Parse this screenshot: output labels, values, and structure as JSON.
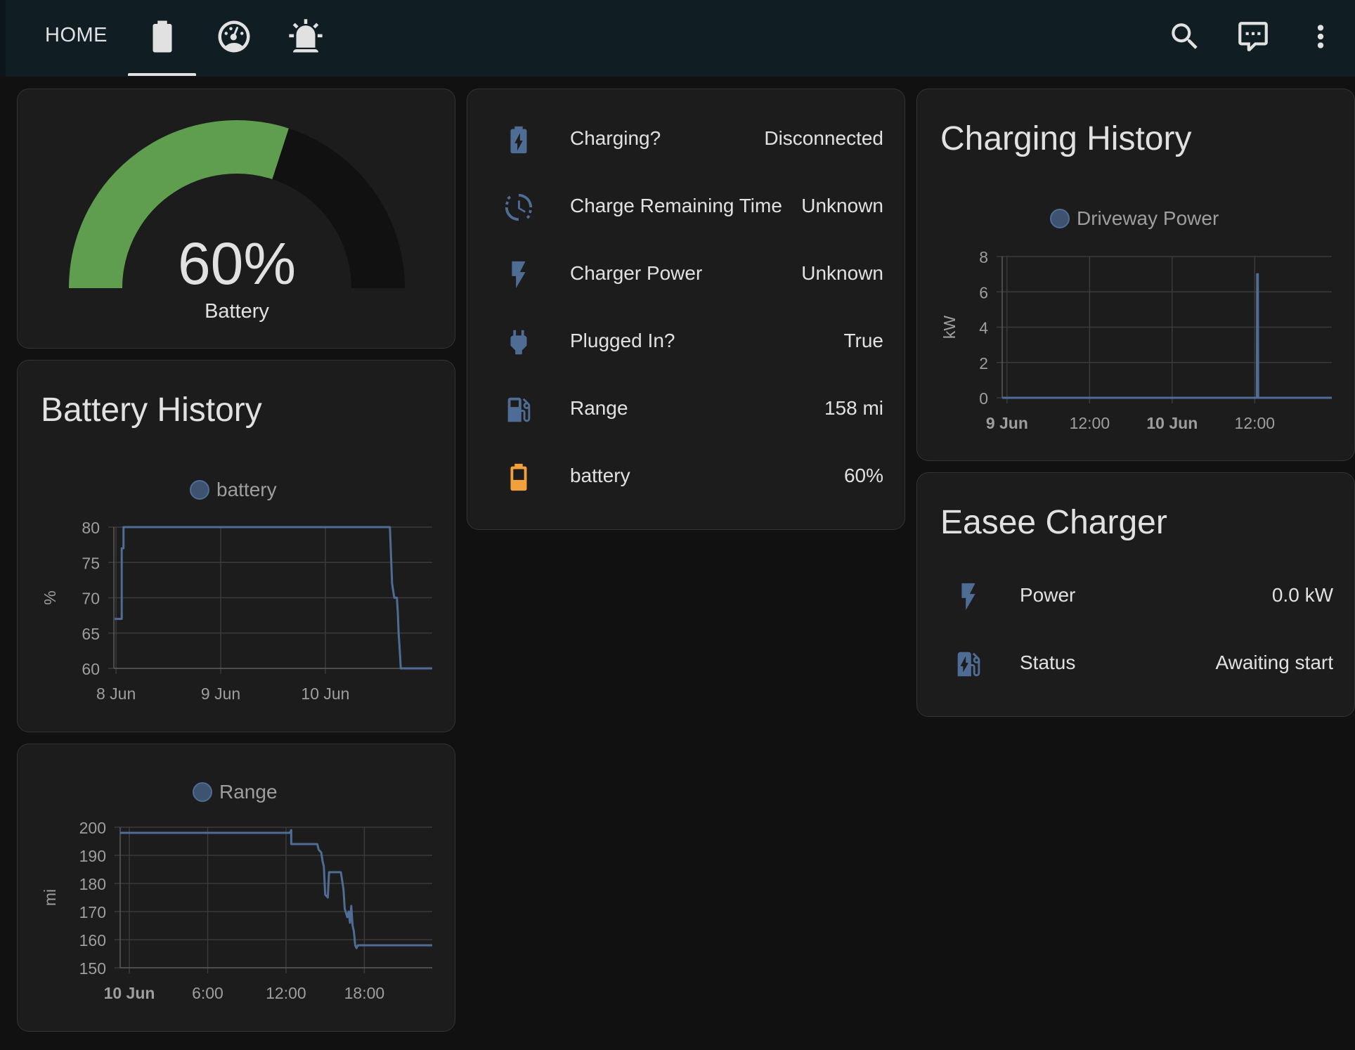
{
  "header": {
    "home_label": "HOME",
    "tabs": [
      {
        "icon": "battery-icon",
        "active": true
      },
      {
        "icon": "speedometer-icon",
        "active": false
      },
      {
        "icon": "alarm-light-icon",
        "active": false
      }
    ],
    "actions": [
      "search-icon",
      "assist-chat-icon",
      "more-vertical-icon"
    ]
  },
  "gauge": {
    "value_text": "60%",
    "label": "Battery",
    "level": 0.6,
    "color": "#5f9e4f"
  },
  "entities": {
    "rows": [
      {
        "icon": "battery-charging-icon",
        "label": "Charging?",
        "value": "Disconnected"
      },
      {
        "icon": "timer-sand-icon",
        "label": "Charge Remaining Time",
        "value": "Unknown"
      },
      {
        "icon": "flash-icon",
        "label": "Charger Power",
        "value": "Unknown"
      },
      {
        "icon": "power-plug-icon",
        "label": "Plugged In?",
        "value": "True"
      },
      {
        "icon": "gas-station-icon",
        "label": "Range",
        "value": "158 mi"
      },
      {
        "icon": "battery-icon",
        "label": "battery",
        "value": "60%"
      }
    ],
    "icon_color": "#4f6c94",
    "battery_icon_color": "#f2a03d"
  },
  "battery_history": {
    "title": "Battery History"
  },
  "charging_history": {
    "title": "Charging History"
  },
  "easee": {
    "title": "Easee Charger",
    "rows": [
      {
        "icon": "flash-icon",
        "label": "Power",
        "value": "0.0 kW"
      },
      {
        "icon": "ev-station-icon",
        "label": "Status",
        "value": "Awaiting start"
      }
    ]
  },
  "chart_data": [
    {
      "id": "battery",
      "type": "line",
      "series": [
        {
          "name": "battery",
          "color": "#4f6c94"
        }
      ],
      "ylabel": "%",
      "ylim": [
        60,
        80
      ],
      "yticks": [
        80,
        75,
        70,
        65,
        60
      ],
      "xticks": [
        "8 Jun",
        "9 Jun",
        "10 Jun"
      ],
      "x_hours": [
        0,
        24,
        48
      ],
      "xlim": [
        -0.5,
        72.5
      ],
      "points": [
        [
          -0.3,
          67
        ],
        [
          1.3,
          67
        ],
        [
          1.3,
          77
        ],
        [
          1.7,
          77
        ],
        [
          1.7,
          80
        ],
        [
          62.8,
          80
        ],
        [
          63.3,
          72
        ],
        [
          63.8,
          70
        ],
        [
          64.4,
          70
        ],
        [
          64.6,
          68
        ],
        [
          64.8,
          65
        ],
        [
          65.1,
          62
        ],
        [
          65.3,
          60
        ],
        [
          72.5,
          60
        ]
      ]
    },
    {
      "id": "range",
      "type": "line",
      "series": [
        {
          "name": "Range",
          "color": "#4f6c94"
        }
      ],
      "ylabel": "mi",
      "ylim": [
        150,
        200
      ],
      "yticks": [
        200,
        190,
        180,
        170,
        160,
        150
      ],
      "xticks": [
        "10 Jun",
        "6:00",
        "12:00",
        "18:00"
      ],
      "xticks_bold": [
        true,
        false,
        false,
        false
      ],
      "x_hours": [
        0,
        6,
        12,
        18
      ],
      "xlim": [
        -0.7,
        23.2
      ],
      "points": [
        [
          -0.7,
          198
        ],
        [
          12.3,
          198
        ],
        [
          12.4,
          199
        ],
        [
          12.4,
          194
        ],
        [
          14.4,
          194
        ],
        [
          14.5,
          192
        ],
        [
          14.7,
          191
        ],
        [
          14.8,
          188
        ],
        [
          14.9,
          186
        ],
        [
          15.0,
          176
        ],
        [
          15.2,
          175
        ],
        [
          15.3,
          184
        ],
        [
          16.2,
          184
        ],
        [
          16.4,
          178
        ],
        [
          16.5,
          171
        ],
        [
          16.7,
          168
        ],
        [
          16.8,
          170
        ],
        [
          16.9,
          166
        ],
        [
          17.0,
          172
        ],
        [
          17.1,
          165
        ],
        [
          17.2,
          163
        ],
        [
          17.3,
          158
        ],
        [
          17.4,
          157
        ],
        [
          17.5,
          158
        ],
        [
          23.2,
          158
        ]
      ]
    },
    {
      "id": "driveway",
      "type": "line",
      "series": [
        {
          "name": "Driveway Power",
          "color": "#4f6c94"
        }
      ],
      "ylabel": "kW",
      "ylim": [
        0,
        8
      ],
      "yticks": [
        8,
        6,
        4,
        2,
        0
      ],
      "xticks": [
        "9 Jun",
        "12:00",
        "10 Jun",
        "12:00"
      ],
      "xticks_bold": [
        true,
        false,
        true,
        false
      ],
      "x_hours": [
        0,
        12,
        24,
        36
      ],
      "xlim": [
        -0.7,
        47.2
      ],
      "points": [
        [
          -0.7,
          0
        ],
        [
          36.3,
          0
        ],
        [
          36.35,
          7
        ],
        [
          36.45,
          7
        ],
        [
          36.5,
          0
        ],
        [
          47.2,
          0
        ]
      ]
    }
  ]
}
